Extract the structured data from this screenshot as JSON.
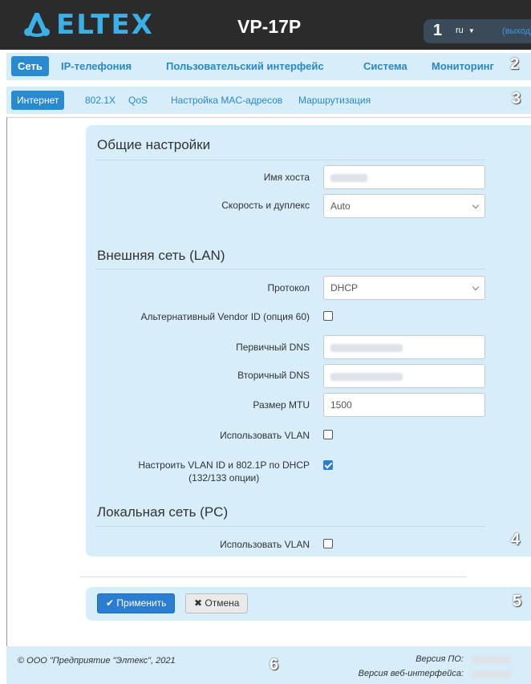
{
  "header": {
    "logo_text": "ELTEX",
    "model": "VP-17P",
    "badge": "1",
    "language": "ru",
    "logout": "(выход)",
    "brand_color": "#3ab0e6"
  },
  "tabs_main": {
    "badge": "2",
    "items": [
      {
        "label": "Сеть",
        "active": true
      },
      {
        "label": "IP-телефония",
        "active": false
      },
      {
        "label": "Пользовательский интерфейс",
        "active": false
      },
      {
        "label": "Система",
        "active": false
      },
      {
        "label": "Мониторинг",
        "active": false
      }
    ]
  },
  "tabs_sub": {
    "badge": "3",
    "items": [
      {
        "label": "Интернет",
        "active": true
      },
      {
        "label": "802.1X",
        "active": false
      },
      {
        "label": "QoS",
        "active": false
      },
      {
        "label": "Настройка MAC-адресов",
        "active": false
      },
      {
        "label": "Маршрутизация",
        "active": false
      }
    ]
  },
  "general": {
    "title": "Общие настройки",
    "hostname_label": "Имя хоста",
    "duplex_label": "Скорость и дуплекс",
    "duplex_value": "Auto"
  },
  "lan": {
    "title": "Внешняя сеть (LAN)",
    "protocol_label": "Протокол",
    "protocol_value": "DHCP",
    "vendor_label": "Альтернативный Vendor ID (опция 60)",
    "vendor_checked": false,
    "dns1_label": "Первичный DNS",
    "dns2_label": "Вторичный DNS",
    "mtu_label": "Размер MTU",
    "mtu_value": "1500",
    "vlan_label": "Использовать VLAN",
    "vlan_checked": false,
    "dhcp_vlan_label_line1": "Настроить VLAN ID и 802.1P по DHCP",
    "dhcp_vlan_label_line2": "(132/133 опции)",
    "dhcp_vlan_checked": true
  },
  "pc": {
    "title": "Локальная сеть (PC)",
    "vlan_label": "Использовать VLAN",
    "vlan_checked": false,
    "badge": "4"
  },
  "actions": {
    "apply_label": "Применить",
    "cancel_label": "Отмена",
    "badge": "5"
  },
  "footer": {
    "copyright": "© ООО \"Предприятие \"Элтекс\", 2021",
    "fw_label": "Версия ПО:",
    "web_label": "Версия веб-интерфейса:",
    "badge": "6"
  }
}
